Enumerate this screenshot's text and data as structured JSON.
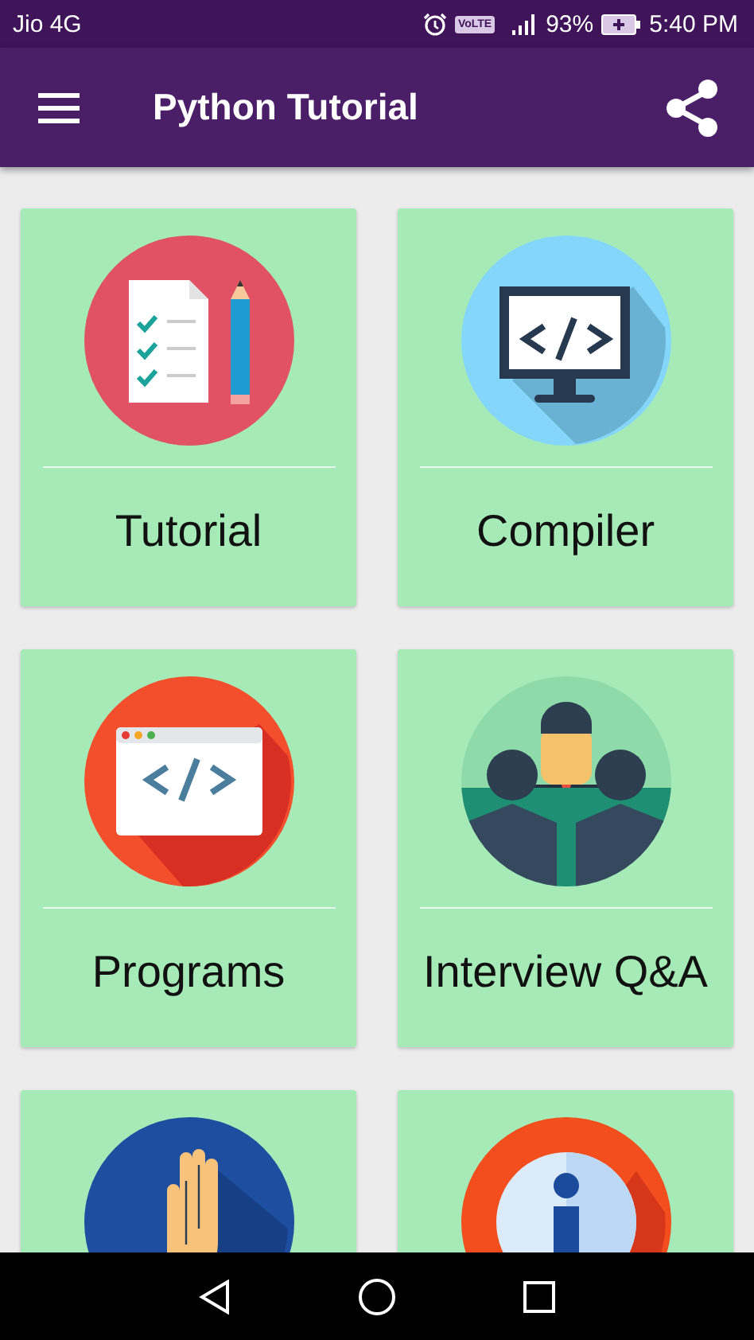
{
  "status_bar": {
    "carrier": "Jio 4G",
    "volte": "VoLTE",
    "battery": "93%",
    "time": "5:40 PM"
  },
  "app_bar": {
    "title": "Python Tutorial"
  },
  "tiles": [
    {
      "label": "Tutorial",
      "kind": "checklist"
    },
    {
      "label": "Compiler",
      "kind": "monitor"
    },
    {
      "label": "Programs",
      "kind": "browser"
    },
    {
      "label": "Interview Q&A",
      "kind": "interview"
    },
    {
      "kind": "hand"
    },
    {
      "kind": "info"
    }
  ]
}
